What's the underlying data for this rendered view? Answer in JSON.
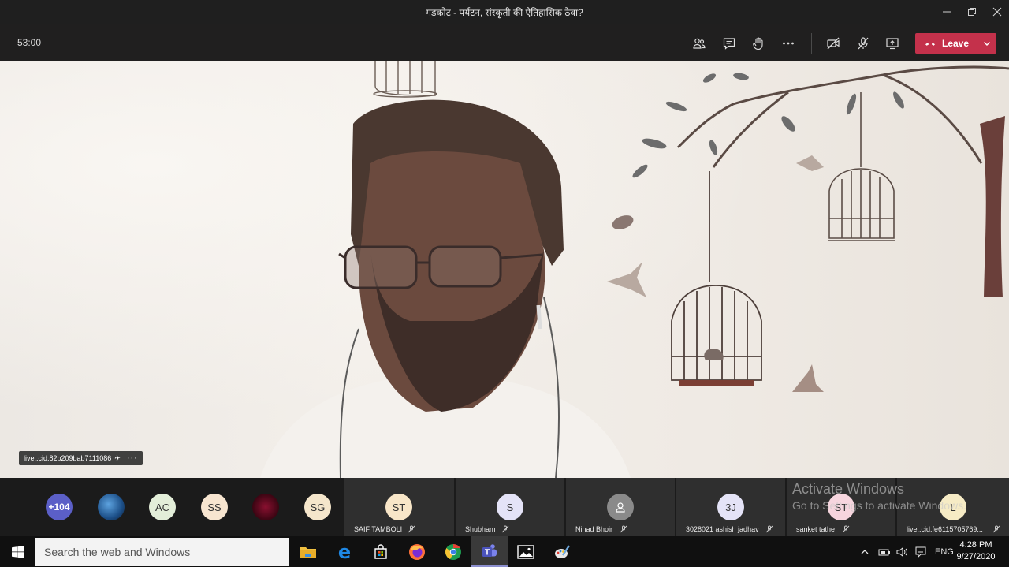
{
  "window": {
    "title": "गडकोट - पर्यटन, संस्कृती की ऐतिहासिक ठेवा?",
    "minimize_icon": "minimize-icon",
    "restore_icon": "restore-icon",
    "close_icon": "close-icon"
  },
  "toolbar": {
    "timer": "53:00",
    "buttons": [
      "participants-icon",
      "chat-icon",
      "raise-hand-icon",
      "more-options-icon",
      "camera-off-icon",
      "mic-off-icon",
      "share-screen-icon"
    ],
    "leave_label": "Leave",
    "leave_color": "#c4314b"
  },
  "video": {
    "label": "live:.cid.82b209bab7111086",
    "pin_icon": "pin-icon",
    "more_icon": "more-icon"
  },
  "gallery": {
    "overflow_count": "+104",
    "avatars": [
      {
        "initials": "",
        "kind": "photo-earth"
      },
      {
        "initials": "AC",
        "color": "#e3eed9"
      },
      {
        "initials": "SS",
        "color": "#f7e5d0"
      },
      {
        "initials": "",
        "kind": "photo-dark"
      },
      {
        "initials": "SG",
        "color": "#f5e6cb"
      }
    ],
    "tiles": [
      {
        "name": "SAIF TAMBOLI",
        "initials": "ST",
        "color": "#f8e6c8"
      },
      {
        "name": "Shubham",
        "initials": "S",
        "color": "#e4e3f7"
      },
      {
        "name": "Ninad Bhoir",
        "initials": "",
        "color": "#8a8a8a"
      },
      {
        "name": "3028021 ashish jadhav",
        "initials": "3J",
        "color": "#e4e3f7"
      },
      {
        "name": "sanket tathe",
        "initials": "ST",
        "color": "#f6d5de"
      },
      {
        "name": "live:.cid.fe6115705769...",
        "initials": "L",
        "color": "#f6ebc5"
      }
    ]
  },
  "watermark": {
    "line1": "Activate Windows",
    "line2": "Go to Settings to activate Windows."
  },
  "taskbar": {
    "search_placeholder": "Search the web and Windows",
    "apps": [
      "file-explorer-icon",
      "edge-icon",
      "store-icon",
      "firefox-icon",
      "chrome-icon",
      "teams-icon",
      "photos-icon",
      "paint-icon"
    ],
    "active_app": "teams-icon",
    "language": "ENG",
    "time": "4:28 PM",
    "date": "9/27/2020"
  }
}
